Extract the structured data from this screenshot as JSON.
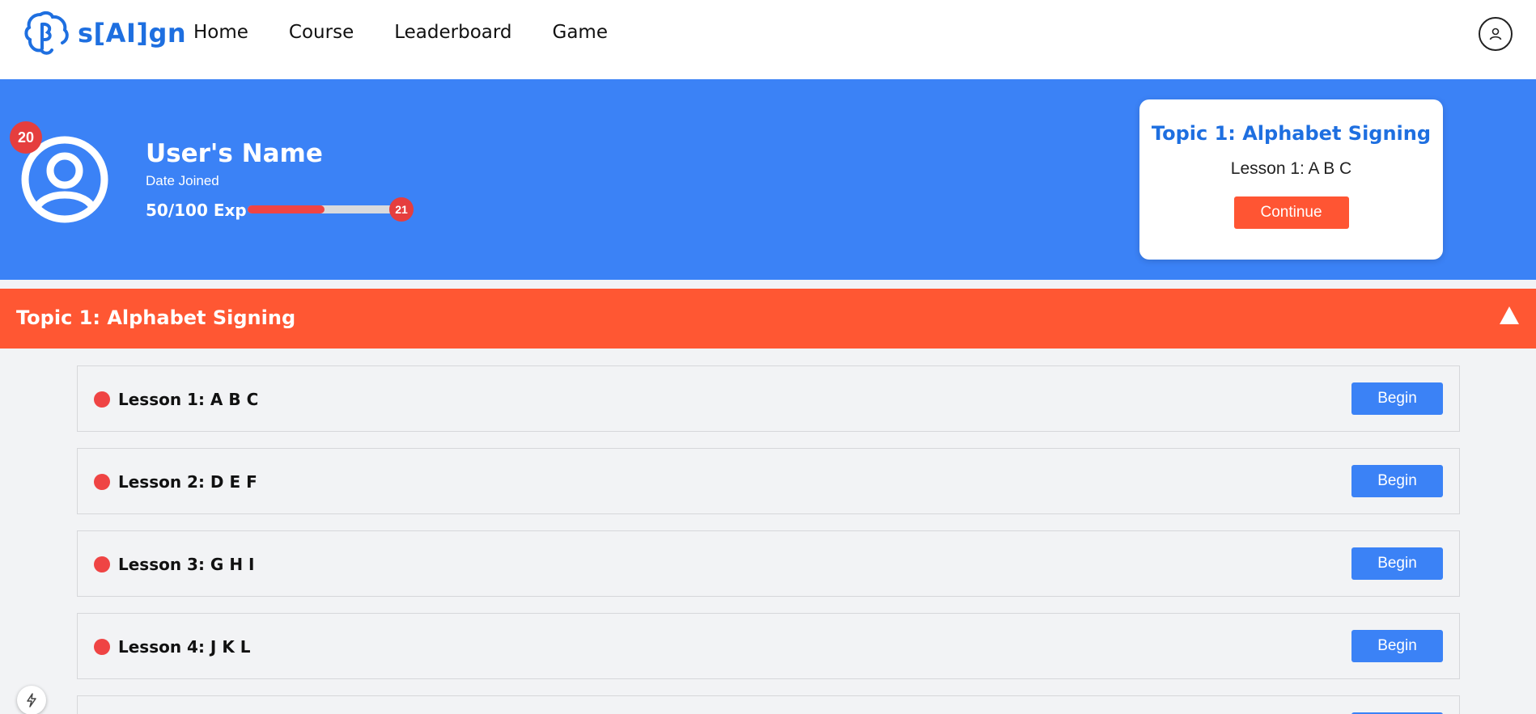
{
  "brand": {
    "name": "s[AI]gn",
    "logo_icon": "brain-icon",
    "color": "#1e6fe0"
  },
  "nav": {
    "items": [
      "Home",
      "Course",
      "Leaderboard",
      "Game"
    ],
    "account_icon": "user-icon"
  },
  "profile": {
    "level": "20",
    "name": "User's Name",
    "date_joined": "Date Joined",
    "exp_text": "50/100 Exp",
    "exp_progress": 0.5,
    "next_level": "21",
    "avatar_icon": "user-circle-icon"
  },
  "continue_card": {
    "topic": "Topic 1: Alphabet Signing",
    "lesson": "Lesson 1: A B C",
    "button": "Continue"
  },
  "topic_section": {
    "title": "Topic 1: Alphabet Signing",
    "toggle_icon": "triangle-up-icon",
    "lessons": [
      {
        "label": "Lesson 1: A B C",
        "button": "Begin"
      },
      {
        "label": "Lesson 2: D E F",
        "button": "Begin"
      },
      {
        "label": "Lesson 3: G H I",
        "button": "Begin"
      },
      {
        "label": "Lesson 4: J K L",
        "button": "Begin"
      }
    ]
  },
  "colors": {
    "hero": "#3b82f6",
    "accent": "#ff5733",
    "status_dot": "#ef4444",
    "badge": "#e53e3e"
  },
  "fab_icon": "lightning-icon"
}
